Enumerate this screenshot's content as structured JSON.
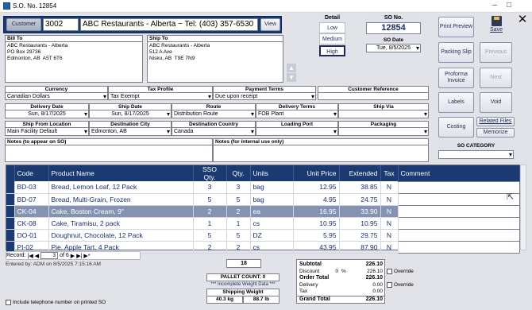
{
  "window": {
    "title": "S.O. No. 12854",
    "minimize": "–",
    "maximize": "□",
    "close": "✕"
  },
  "customer": {
    "button": "Customer",
    "code": "3002",
    "name": "ABC Restaurants - Alberta  ~  Tel: (403) 357-6530",
    "view": "View"
  },
  "bill_to": {
    "label": "Bill To",
    "text": "ABC Restaurants - Alberta\nPO Box 29736\nEdmonton, AB  A5T 6T6"
  },
  "ship_to": {
    "label": "Ship To",
    "text": "ABC Restaurants - Alberta\n512 A Ave\nNisku, AB  T9E 7N9"
  },
  "detail": {
    "label": "Detail",
    "options": [
      "Low",
      "Medium",
      "High"
    ]
  },
  "so": {
    "no_label": "SO No.",
    "no": "12854",
    "date_label": "SO Date",
    "date": "Tue, 8/5/2025"
  },
  "actions": {
    "print_preview": "Print Preview",
    "save": "Save",
    "packing_slip": "Packing Slip",
    "previous": "Previous",
    "proforma": "Proforma Invoice",
    "next": "Next",
    "labels": "Labels",
    "void": "Void",
    "costing": "Costing",
    "related_files": "Related Files",
    "memorize": "Memorize"
  },
  "so_category": {
    "label": "SO CATEGORY",
    "value": ""
  },
  "fields": {
    "currency": {
      "label": "Currency",
      "value": "Canadian Dollars"
    },
    "tax_profile": {
      "label": "Tax Profile",
      "value": "Tax Exempt"
    },
    "payment_terms": {
      "label": "Payment Terms",
      "value": "Due upon receipt"
    },
    "customer_reference": {
      "label": "Customer Reference",
      "value": ""
    },
    "delivery_date": {
      "label": "Delivery Date",
      "value": "Sun, 8/17/2025"
    },
    "ship_date": {
      "label": "Ship Date",
      "value": "Sun, 8/17/2025"
    },
    "route": {
      "label": "Route",
      "value": "Distribution Route"
    },
    "delivery_terms": {
      "label": "Delivery Terms",
      "value": "FOB Plant"
    },
    "ship_via": {
      "label": "Ship Via",
      "value": ""
    },
    "ship_from": {
      "label": "Ship From Location",
      "value": "Main Facility Default"
    },
    "dest_city": {
      "label": "Destination City",
      "value": "Edmonton, AB"
    },
    "dest_country": {
      "label": "Destination Country",
      "value": "Canada"
    },
    "loading_port": {
      "label": "Loading Port",
      "value": ""
    },
    "packaging": {
      "label": "Packaging",
      "value": ""
    },
    "notes_so": {
      "label": "Notes (to appear on SO)",
      "value": ""
    },
    "notes_internal": {
      "label": "Notes (for internal use only)",
      "value": ""
    }
  },
  "grid": {
    "headers": [
      "Code",
      "Product Name",
      "SSO Qty.",
      "Qty.",
      "Units",
      "Unit Price",
      "Extended",
      "Tax",
      "Comment"
    ],
    "rows": [
      [
        "BD-03",
        "Bread, Lemon Loaf, 12 Pack",
        "3",
        "3",
        "bag",
        "12.95",
        "38.85",
        "N",
        ""
      ],
      [
        "BD-07",
        "Bread, Multi-Grain, Frozen",
        "5",
        "5",
        "bag",
        "4.95",
        "24.75",
        "N",
        ""
      ],
      [
        "CK-04",
        "Cake, Boston Cream, 9\"",
        "2",
        "2",
        "ea",
        "16.95",
        "33.90",
        "N",
        ""
      ],
      [
        "CK-08",
        "Cake, Tiramisu, 2 pack",
        "1",
        "1",
        "cs",
        "10.95",
        "10.95",
        "N",
        ""
      ],
      [
        "DO-01",
        "Doughnut, Chocolate, 12 Pack",
        "5",
        "5",
        "DZ",
        "5.95",
        "29.75",
        "N",
        ""
      ],
      [
        "PI-02",
        "Pie, Apple Tart, 4 Pack",
        "2",
        "2",
        "cs",
        "43.95",
        "87.90",
        "N",
        ""
      ]
    ],
    "selected_row": 2
  },
  "record_nav": {
    "label": "Record:",
    "current": "3",
    "of": "of 6"
  },
  "entered_by": "Entered by: ADM on 8/5/2025 7:15:16 AM",
  "totals_qty": "18",
  "pallet_count": "PALLET COUNT: 0",
  "incomplete_weight": "*** Incomplete Weight Data ***",
  "shipping_weight": {
    "label": "Shipping Weight",
    "kg": "40.3 kg",
    "lb": "88.7 lb"
  },
  "summary": {
    "subtotal_label": "Subtotal",
    "subtotal": "226.10",
    "discount_label": "Discount",
    "discount_pct": "0",
    "pct_sign": "%",
    "discount": "226.10",
    "override": "Override",
    "order_total_label": "Order Total",
    "order_total": "226.10",
    "delivery_label": "Delivery",
    "delivery": "0.00",
    "tax_label": "Tax",
    "tax": "0.00",
    "grand_total_label": "Grand Total",
    "grand_total": "226.10"
  },
  "include_phone": "Include telephone number on printed SO"
}
